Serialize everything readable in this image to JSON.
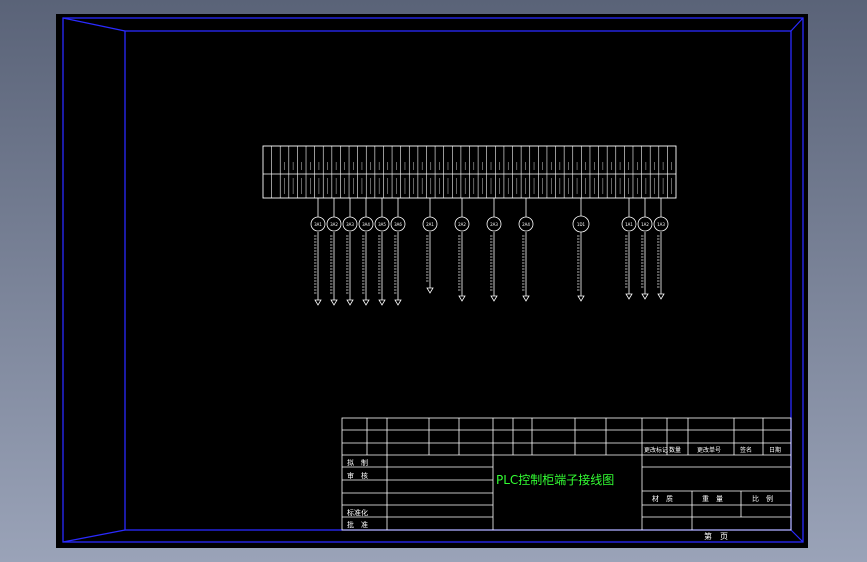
{
  "colors": {
    "canvas": "#000000",
    "frame": "#2a2aff",
    "lines": "#ffffff",
    "title_text": "#33ff33"
  },
  "title_block": {
    "drawing_title": "PLC控制柜端子接线图",
    "row_labels": [
      "拟　制",
      "审　核",
      "标准化",
      "批　准"
    ],
    "header_cells": [
      "更改标记",
      "数量",
      "更改单号",
      "签名",
      "日期"
    ],
    "material_cells": [
      "材　质",
      "重　量",
      "比　例"
    ],
    "sheet_cell": "第　页"
  },
  "terminals": {
    "count": 48,
    "groups": [
      {
        "bubble": "3A1"
      },
      {
        "bubble": "3A2"
      },
      {
        "bubble": "3A3"
      },
      {
        "bubble": "3A4"
      },
      {
        "bubble": "3A5"
      },
      {
        "bubble": "3A6"
      },
      {
        "bubble": "2A1"
      },
      {
        "bubble": "2A2"
      },
      {
        "bubble": "2A3"
      },
      {
        "bubble": "2A4"
      },
      {
        "bubble": "1D1"
      },
      {
        "bubble": "1A1"
      },
      {
        "bubble": "1A2"
      },
      {
        "bubble": "1A3"
      }
    ]
  }
}
